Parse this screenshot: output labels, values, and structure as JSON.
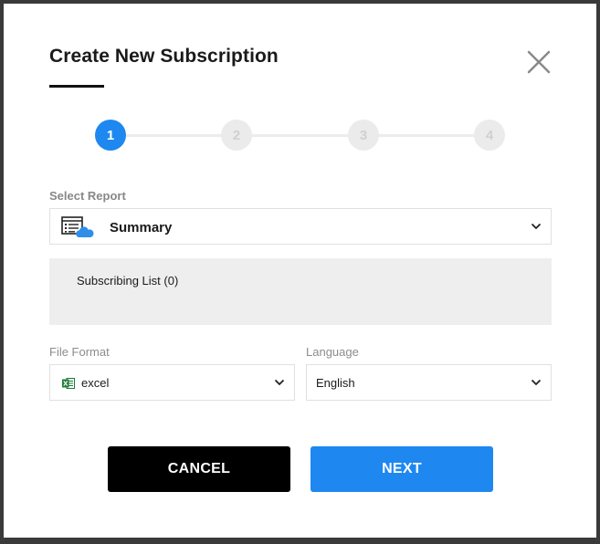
{
  "dialog": {
    "title": "Create New Subscription"
  },
  "stepper": {
    "steps": [
      "1",
      "2",
      "3",
      "4"
    ],
    "active_index": 0
  },
  "report": {
    "label": "Select Report",
    "selected": "Summary",
    "icon": "report-list-cloud-icon"
  },
  "subscribing_list": {
    "text": "Subscribing List (0)"
  },
  "file_format": {
    "label": "File Format",
    "selected": "excel",
    "icon": "excel-icon"
  },
  "language": {
    "label": "Language",
    "selected": "English"
  },
  "buttons": {
    "cancel": "CANCEL",
    "next": "NEXT"
  },
  "colors": {
    "accent": "#1e88f0",
    "cancel_bg": "#000000",
    "excel_green": "#1f7a3a"
  }
}
